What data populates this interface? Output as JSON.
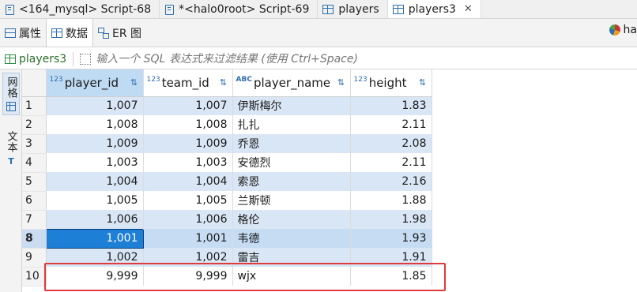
{
  "tabs": [
    {
      "label": "<164_mysql> Script-68",
      "icon": "script-icon",
      "active": false
    },
    {
      "label": "*<halo0root> Script-69",
      "icon": "script-icon",
      "active": false
    },
    {
      "label": "players",
      "icon": "table-icon",
      "active": false
    },
    {
      "label": "players3",
      "icon": "table-icon",
      "active": true
    }
  ],
  "subtabs": [
    {
      "label": "属性",
      "icon": "properties-icon"
    },
    {
      "label": "数据",
      "icon": "table-icon",
      "active": true
    },
    {
      "label": "ER 图",
      "icon": "er-diagram-icon"
    }
  ],
  "right_tool": {
    "label": "ha"
  },
  "filter": {
    "source": "players3",
    "placeholder": "输入一个 SQL 表达式来过滤结果 (使用 Ctrl+Space)"
  },
  "side_tabs": [
    {
      "label": "网格",
      "active": true
    },
    {
      "label": "文本",
      "active": false
    }
  ],
  "table": {
    "columns": [
      {
        "type": "123",
        "name": "player_id"
      },
      {
        "type": "123",
        "name": "team_id"
      },
      {
        "type": "ABC",
        "name": "player_name"
      },
      {
        "type": "123",
        "name": "height"
      }
    ],
    "rows": [
      {
        "n": "1",
        "player_id": "1,007",
        "team_id": "1,007",
        "player_name": "伊斯梅尔",
        "height": "1.83"
      },
      {
        "n": "2",
        "player_id": "1,008",
        "team_id": "1,008",
        "player_name": "扎扎",
        "height": "2.11"
      },
      {
        "n": "3",
        "player_id": "1,009",
        "team_id": "1,009",
        "player_name": "乔恩",
        "height": "2.08"
      },
      {
        "n": "4",
        "player_id": "1,003",
        "team_id": "1,003",
        "player_name": "安德烈",
        "height": "2.11"
      },
      {
        "n": "5",
        "player_id": "1,004",
        "team_id": "1,004",
        "player_name": "索恩",
        "height": "2.16"
      },
      {
        "n": "6",
        "player_id": "1,005",
        "team_id": "1,005",
        "player_name": "兰斯顿",
        "height": "1.88"
      },
      {
        "n": "7",
        "player_id": "1,006",
        "team_id": "1,006",
        "player_name": "格伦",
        "height": "1.98"
      },
      {
        "n": "8",
        "player_id": "1,001",
        "team_id": "1,001",
        "player_name": "韦德",
        "height": "1.93"
      },
      {
        "n": "9",
        "player_id": "1,002",
        "team_id": "1,002",
        "player_name": "雷吉",
        "height": "1.91"
      },
      {
        "n": "10",
        "player_id": "9,999",
        "team_id": "9,999",
        "player_name": "wjx",
        "height": "1.85"
      }
    ]
  },
  "colors": {
    "selection": "#1e7fd6",
    "row_band": "#d9e6f5",
    "highlight_box": "#e03a3a"
  }
}
